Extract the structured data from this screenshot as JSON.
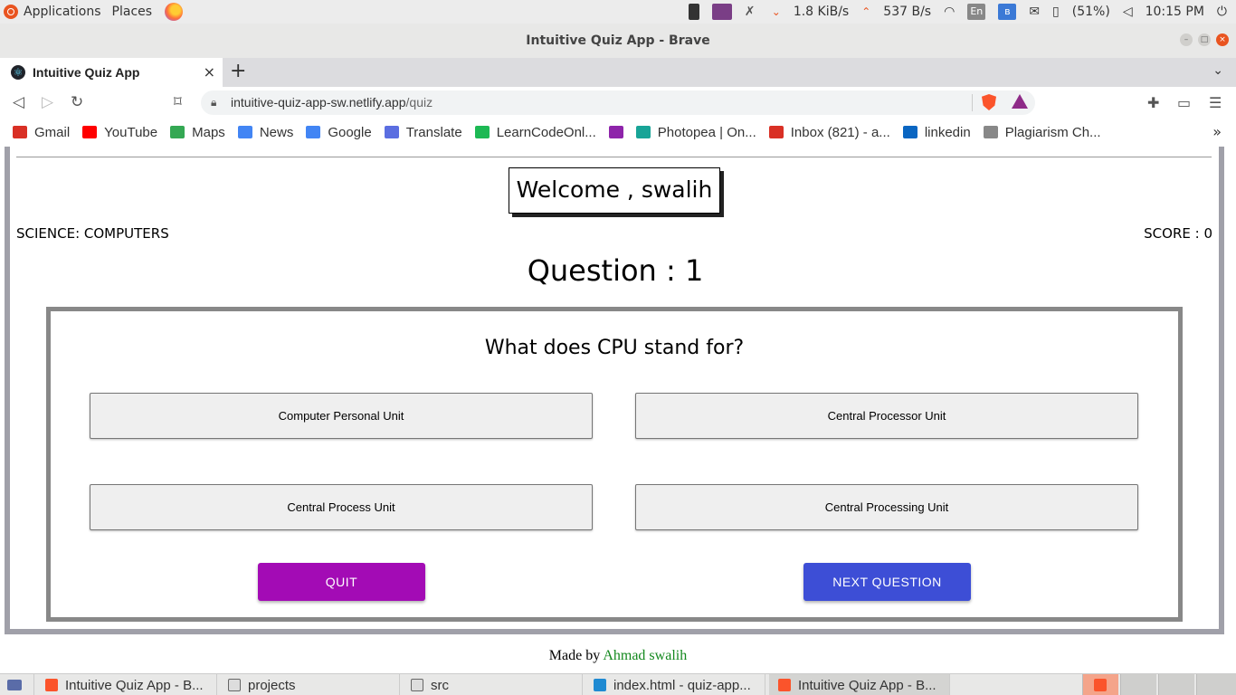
{
  "system_panel": {
    "applications": "Applications",
    "places": "Places",
    "download_speed": "1.8 KiB/s",
    "upload_speed": "537 B/s",
    "keyboard_layout": "En",
    "battery": "(51%)",
    "clock": "10:15 PM"
  },
  "window": {
    "title": "Intuitive Quiz App - Brave"
  },
  "browser": {
    "tab_title": "Intuitive Quiz App",
    "url_host": "intuitive-quiz-app-sw.netlify.app",
    "url_path": "/quiz",
    "bookmarks": [
      {
        "label": "Gmail",
        "icon": "gmail-icon",
        "color": "#d93025"
      },
      {
        "label": "YouTube",
        "icon": "youtube-icon",
        "color": "#ff0000"
      },
      {
        "label": "Maps",
        "icon": "maps-icon",
        "color": "#34a853"
      },
      {
        "label": "News",
        "icon": "news-icon",
        "color": "#4285f4"
      },
      {
        "label": "Google",
        "icon": "google-icon",
        "color": "#4285f4"
      },
      {
        "label": "Translate",
        "icon": "translate-icon",
        "color": "#5b6ee1"
      },
      {
        "label": "LearnCodeOnl...",
        "icon": "play-icon",
        "color": "#1db954"
      },
      {
        "label": "",
        "icon": "u-icon",
        "color": "#8e24aa"
      },
      {
        "label": "Photopea | On...",
        "icon": "photopea-icon",
        "color": "#18a497"
      },
      {
        "label": "Inbox (821) - a...",
        "icon": "gmail-icon",
        "color": "#d93025"
      },
      {
        "label": "linkedin",
        "icon": "linkedin-icon",
        "color": "#0a66c2"
      },
      {
        "label": "Plagiarism Ch...",
        "icon": "sst-icon",
        "color": "#888888"
      }
    ]
  },
  "quiz": {
    "welcome": "Welcome , swalih",
    "category": "SCIENCE: COMPUTERS",
    "score": "SCORE : 0",
    "question_number": "Question : 1",
    "question": "What does CPU stand for?",
    "options": [
      "Computer Personal Unit",
      "Central Processor Unit",
      "Central Process Unit",
      "Central Processing Unit"
    ],
    "quit_label": "QUIT",
    "next_label": "NEXT QUESTION",
    "footer_prefix": "Made by ",
    "footer_author": "Ahmad swalih"
  },
  "taskbar": {
    "tasks": [
      "Intuitive Quiz App - B...",
      "projects",
      "src",
      "index.html - quiz-app...",
      "Intuitive Quiz App - B..."
    ]
  },
  "colors": {
    "quit_button": "#a30bb5",
    "next_button": "#3d4ed6",
    "footer_author": "#12881d",
    "frame_border": "#a0a0a9"
  }
}
